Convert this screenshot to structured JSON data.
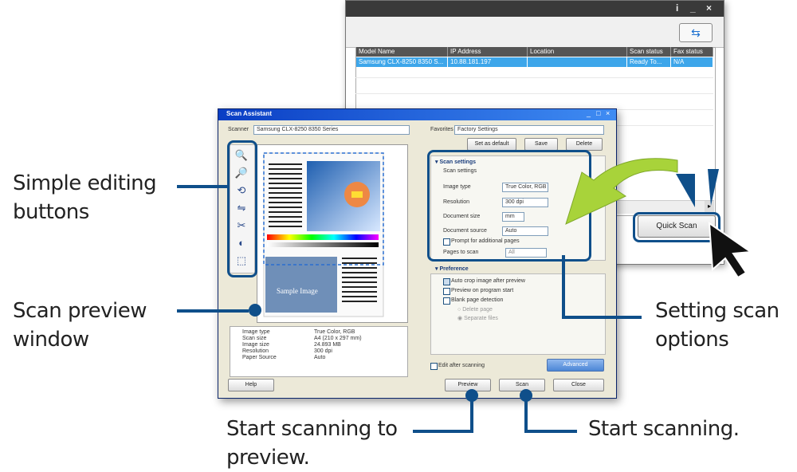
{
  "callouts": {
    "editing_line1": "Simple editing",
    "editing_line2": "buttons",
    "preview_line1": "Scan preview",
    "preview_line2": "window",
    "settings_line1": "Setting scan",
    "settings_line2": "options",
    "start_preview_line1": "Start scanning to",
    "start_preview_line2": "preview.",
    "start_scan": "Start scanning."
  },
  "colors": {
    "callout_blue": "#0f4f8a",
    "accent_green": "#9fd22a",
    "row_select": "#3da6ea"
  },
  "background_window": {
    "controls": [
      "i",
      "_",
      "×"
    ],
    "refresh_icon": "refresh-icon",
    "columns": [
      "Model Name",
      "IP Address",
      "Location",
      "Scan status",
      "Fax status"
    ],
    "row": [
      "Samsung CLX-8250 8350 S...",
      "10.88.181.197",
      "",
      "Ready To...",
      "N/A"
    ],
    "quick_scan": "Quick Scan"
  },
  "scan_assistant": {
    "title": "Scan Assistant",
    "scanner_label": "Scanner",
    "scanner_value": "Samsung CLX-8250 8350 Series",
    "favorites_label": "Favorites",
    "favorites_value": "Factory Settings",
    "fav_buttons": [
      "Set as default",
      "Save",
      "Delete"
    ],
    "scan_settings_header": "Scan settings",
    "scan_settings_sub": "Scan settings",
    "settings": [
      {
        "label": "Image type",
        "value": "True Color, RGB"
      },
      {
        "label": "Resolution",
        "value": "300 dpi"
      },
      {
        "label": "Document size",
        "value": "mm"
      },
      {
        "label": "Document source",
        "value": "Auto"
      }
    ],
    "prompt_additional": "Prompt for additional pages",
    "pages_to_scan": "Pages to scan",
    "pages_value": "All",
    "preference_header": "Preference",
    "pref_items": [
      "Auto crop image after preview",
      "Preview on program start",
      "Blank page detection",
      "Delete page",
      "Separate files"
    ],
    "sample_image_label": "Sample Image",
    "info_labels": [
      "Image type",
      "Scan size",
      "Image size",
      "Resolution",
      "Paper Source"
    ],
    "info_values": [
      "True Color, RGB",
      "A4 (210 x 297 mm)",
      "24.893 MB",
      "300 dpi",
      "Auto"
    ],
    "edit_after": "Edit after scanning",
    "advanced": "Advanced",
    "help": "Help",
    "preview": "Preview",
    "scan": "Scan",
    "close": "Close"
  }
}
